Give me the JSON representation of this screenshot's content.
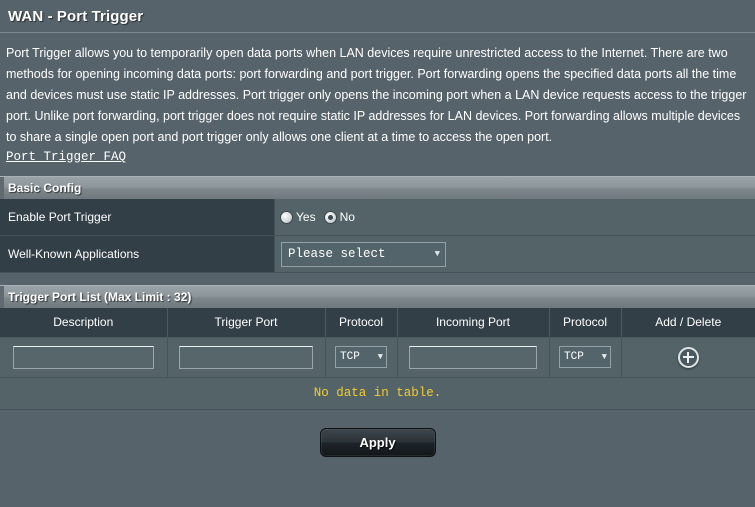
{
  "page": {
    "title": "WAN - Port Trigger",
    "description": "Port Trigger allows you to temporarily open data ports when LAN devices require unrestricted access to the Internet. There are two methods for opening incoming data ports: port forwarding and port trigger. Port forwarding opens the specified data ports all the time and devices must use static IP addresses. Port trigger only opens the incoming port when a LAN device requests access to the trigger port. Unlike port forwarding, port trigger does not require static IP addresses for LAN devices. Port forwarding allows multiple devices to share a single open port and port trigger only allows one client at a time to access the open port.",
    "faq_link": "Port Trigger FAQ"
  },
  "basic_config": {
    "section_title": "Basic Config",
    "enable_port_trigger": {
      "label": "Enable Port Trigger",
      "options": [
        "Yes",
        "No"
      ],
      "selected": "No"
    },
    "well_known_applications": {
      "label": "Well-Known Applications",
      "value": "Please select",
      "caret": "▼"
    }
  },
  "trigger_port_list": {
    "section_title": "Trigger Port List (Max Limit : 32)",
    "columns": [
      "Description",
      "Trigger Port",
      "Protocol",
      "Incoming Port",
      "Protocol",
      "Add / Delete"
    ],
    "entry_row": {
      "description_value": "",
      "description_placeholder": "",
      "trigger_port_value": "",
      "trigger_port_placeholder": "",
      "protocol_trigger": "TCP",
      "incoming_port_value": "",
      "incoming_port_placeholder": "",
      "protocol_incoming": "TCP",
      "caret": "▼",
      "add_icon": "plus-icon"
    },
    "empty_message": "No data in table."
  },
  "footer": {
    "apply_label": "Apply"
  },
  "colors": {
    "background": "#56636a",
    "label_column": "#333f47",
    "value_column": "#536368",
    "section_bar": "#8d979b",
    "warning_text": "#f4cc2e"
  }
}
